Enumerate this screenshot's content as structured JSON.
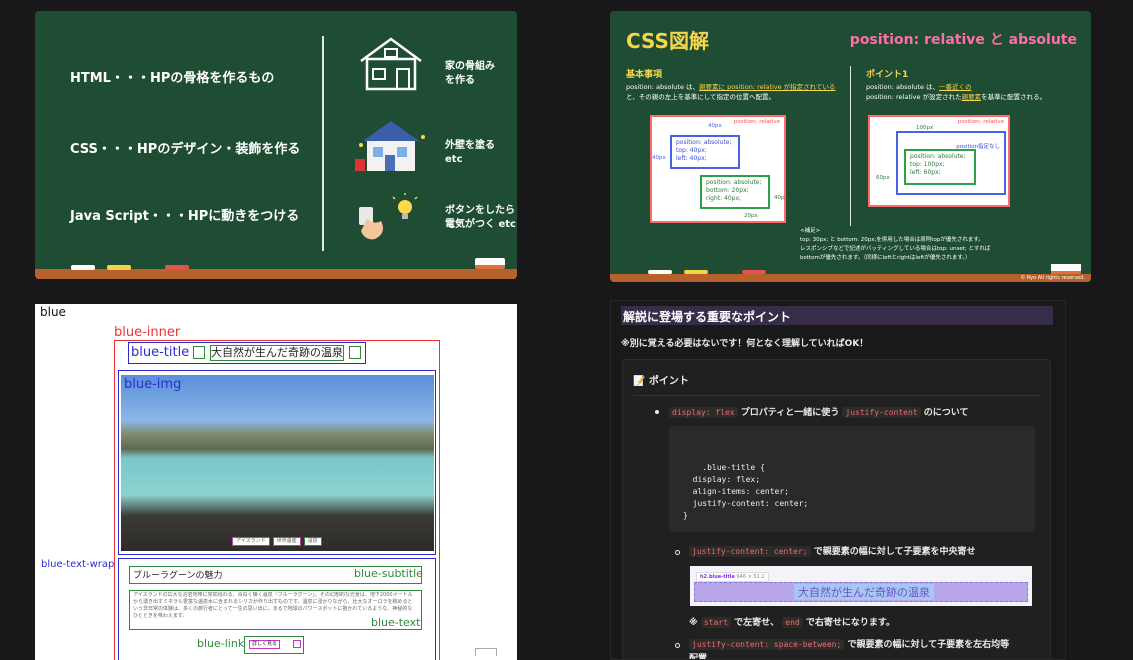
{
  "chalkboard": {
    "rows": [
      "HTML・・・HPの骨格を作るもの",
      "CSS・・・HPのデザイン・装飾を作る",
      "Java Script・・・HPに動きをつける"
    ],
    "notes": [
      "家の骨組み\nを作る",
      "外壁を塗る\netc",
      "ボタンをしたら\n電気がつく etc"
    ]
  },
  "diagram": {
    "title": "CSS図解",
    "subtitle": "position: relative と absolute",
    "left_heading": "基本事項",
    "left_text_a": "position: absolute は、",
    "left_text_u": "親要素に position: relative が指定されている",
    "left_text_b": "と、その親の左上を基準にして指定の位置へ配置。",
    "right_heading": "ポイント1",
    "right_text_a": "position: absolute は、",
    "right_text_u1": "一番近くの",
    "right_text_b": "position: relative が設定された",
    "right_text_u2": "親要素",
    "right_text_c": "を基準に配置される。",
    "relative_label": "position: relative",
    "box_a": "position: absolute;\ntop: 40px;\nleft: 40px;",
    "box_b": "position: absolute;\nbottom: 20px;\nright: 40px;",
    "box_c_label": "position指定なし",
    "box_d": "position: absolute;\ntop: 100px;\nleft: 60px;",
    "dim_40px": "40px",
    "dim_20px": "20px",
    "dim_100px": "100px",
    "dim_60px": "60px",
    "note_head": "<補足>",
    "note_1": "top: 30px; と bottom: 20px;を併用した場合は原則topが優先されます。",
    "note_2": "レスポンシブなどで記述がバッティングしている場合はtop: unset; とすれば",
    "note_3": "bottomが優先されます。（同様にleftとrightはleftが優先されます。）",
    "copyright": "© Ryo All rights reserved."
  },
  "wireframe": {
    "blue": "blue",
    "blue_inner": "blue-inner",
    "blue_title": "blue-title",
    "title_text": "大自然が生んだ奇跡の温泉",
    "blue_img": "blue-img",
    "tags": [
      "アイスランド",
      "世界遺産",
      "温泉"
    ],
    "blue_text_wrap": "blue-text-wrap",
    "subtitle_text": "ブルーラグーンの魅力",
    "blue_subtitle": "blue-subtitle",
    "body_text": "アイスランドの広大な溶岩地帯に突如現れる、青白く輝く温泉「ブルーラグーン」。その幻想的な光景は、地下2000メートルから湧き出すミネラル豊富な温泉水に含まれるシリカが作り出すものです。温泉に浸かりながら、壮大なオーロラを眺めるという非日常の体験は、多くの旅行者にとって一生の思い出に。まるで地球のパワースポットに抱かれているような、神秘的なひとときを味わえます。",
    "blue_text": "blue-text",
    "blue_link": "blue-link",
    "link_text": "詳しく見る"
  },
  "notion": {
    "header": "解説に登場する重要なポイント",
    "intro": "※別に覚える必要はないです！何となく理解していればOK！",
    "callout_title": "📝 ポイント",
    "b1_code": "display: flex",
    "b1_mid": "プロパティと一緒に使う",
    "b1_code2": "justify-content",
    "b1_end": "のについて",
    "code": ".blue-title {\n  display: flex;\n  align-items: center;\n  justify-content: center;\n}",
    "s1_code": "justify-content: center;",
    "s1_text": "で親要素の幅に対して子要素を中央寄せ",
    "demo_tag": "h2.blue-title",
    "demo_size": "946 × 51.2",
    "demo_text": "大自然が生んだ奇跡の温泉",
    "s1_note_a": "※",
    "s1_note_code1": "start",
    "s1_note_b": "で左寄せ、",
    "s1_note_code2": "end",
    "s1_note_c": "で右寄せになります。",
    "s2_code": "justify-content: space-between;",
    "s2_text": "で親要素の幅に対して子要素を左右均等",
    "s2_text2": "配置"
  }
}
